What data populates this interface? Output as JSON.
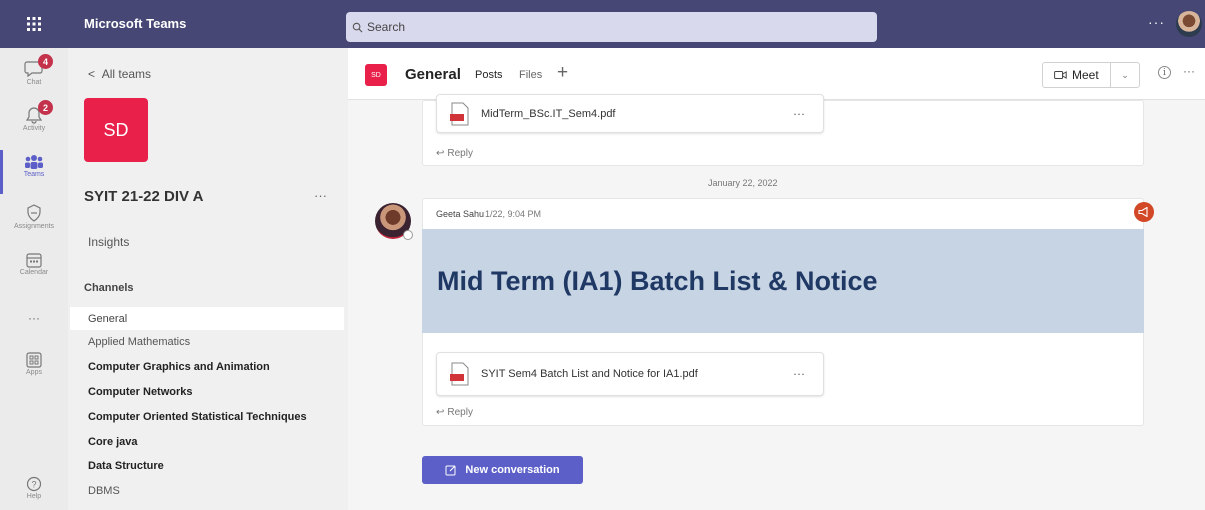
{
  "topbar": {
    "app_title": "Microsoft Teams",
    "search_placeholder": "Search",
    "more": "···",
    "color": "#464775"
  },
  "rail": {
    "items": [
      {
        "label": "Chat",
        "icon": "chat-icon",
        "badge": "4"
      },
      {
        "label": "Activity",
        "icon": "bell-icon",
        "badge": "2"
      },
      {
        "label": "Teams",
        "icon": "teams-icon",
        "active": true
      },
      {
        "label": "Assignments",
        "icon": "assignments-icon"
      },
      {
        "label": "Calendar",
        "icon": "calendar-icon"
      },
      {
        "label": "···",
        "icon": "more-icon"
      },
      {
        "label": "Apps",
        "icon": "apps-icon"
      },
      {
        "label": "Help",
        "icon": "help-icon"
      }
    ]
  },
  "panel": {
    "back_label": "All teams",
    "team_initials": "SD",
    "team_name": "SYIT 21-22 DIV A",
    "team_more": "···",
    "insights": "Insights",
    "channels_header": "Channels",
    "channels": [
      "General",
      "Applied Mathematics",
      "Computer Graphics and Animation",
      "Computer Networks",
      "Computer Oriented Statistical Techniques",
      "Core java",
      "Data Structure",
      "DBMS"
    ]
  },
  "header": {
    "tile": "SD",
    "title": "General",
    "tabs": [
      "Posts",
      "Files"
    ],
    "add_tab": "+",
    "meet_label": "Meet",
    "info": "i",
    "more": "···"
  },
  "conversation": {
    "file1": "MidTerm_BSc.IT_Sem4.pdf",
    "file_more": "···",
    "reply_label": "Reply",
    "date_separator": "January 22, 2022",
    "author": "Geeta Sahu",
    "timestamp": "1/22, 9:04 PM",
    "announcement": "Mid Term (IA1) Batch List & Notice",
    "file2": "SYIT Sem4 Batch List and Notice for IA1.pdf",
    "new_conversation": "New conversation",
    "announcement_bg": "#c7d4e4",
    "accent": "#5b5fc7"
  }
}
